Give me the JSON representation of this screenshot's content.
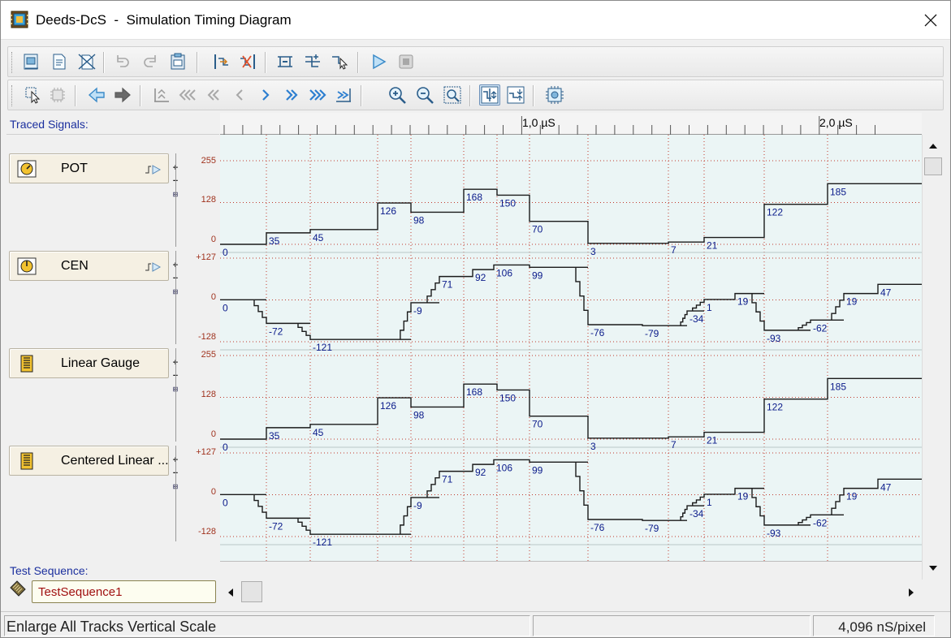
{
  "window": {
    "title": "Deeds-DcS  -  Simulation Timing Diagram"
  },
  "toolbar1": [
    {
      "icon": "new-diagram-icon"
    },
    {
      "icon": "open-file-icon"
    },
    {
      "icon": "delete-file-icon"
    },
    {
      "icon": "undo-icon"
    },
    {
      "icon": "redo-icon"
    },
    {
      "icon": "clipboard-icon"
    },
    {
      "icon": "insert-signal-icon"
    },
    {
      "icon": "remove-signal-icon"
    },
    {
      "icon": "align-signals-icon"
    },
    {
      "icon": "split-signals-icon"
    },
    {
      "icon": "select-pointer-icon"
    },
    {
      "icon": "play-icon"
    },
    {
      "icon": "stop-icon"
    }
  ],
  "toolbar2": [
    {
      "icon": "pointer-select-icon"
    },
    {
      "icon": "chip-disabled-icon"
    },
    {
      "icon": "arrow-left-icon"
    },
    {
      "icon": "arrow-right-icon"
    },
    {
      "icon": "go-start-icon"
    },
    {
      "icon": "fast-rewind-3-icon"
    },
    {
      "icon": "fast-rewind-2-icon"
    },
    {
      "icon": "step-back-icon"
    },
    {
      "icon": "step-forward-icon"
    },
    {
      "icon": "fast-forward-2-icon"
    },
    {
      "icon": "fast-forward-3-icon"
    },
    {
      "icon": "go-end-icon"
    },
    {
      "icon": "zoom-in-icon"
    },
    {
      "icon": "zoom-out-icon"
    },
    {
      "icon": "zoom-fit-icon"
    },
    {
      "icon": "enlarge-tracks-icon",
      "pressed": true
    },
    {
      "icon": "reduce-tracks-icon"
    },
    {
      "icon": "settings-chip-icon"
    }
  ],
  "left": {
    "traced_label": "Traced Signals:",
    "test_sequence_label": "Test Sequence:",
    "test_sequence_value": "TestSequence1"
  },
  "ruler": {
    "labels": [
      "1,0 µS",
      "2,0 µS"
    ]
  },
  "status": {
    "message": "Enlarge All Tracks Vertical Scale",
    "scale": "4,096 nS/pixel"
  },
  "colors": {
    "trace": "#1a1a1a",
    "value_label": "#0a1a8a",
    "grid_dot": "#c0392b",
    "scale_label": "#a0321e",
    "plot_bg": "#ebf5f5"
  },
  "chart_data": {
    "type": "line",
    "title": "",
    "xlabel": "",
    "ylabel": "",
    "x_unit": "µS",
    "x_tick_labels": [
      "1,0 µS",
      "2,0 µS"
    ],
    "series": [
      {
        "name": "POT",
        "icon": "knob-icon",
        "y_tick_labels": [
          "255",
          "128",
          "0"
        ],
        "ylim": [
          0,
          255
        ],
        "values": [
          0,
          35,
          45,
          126,
          98,
          168,
          150,
          70,
          3,
          7,
          21,
          122,
          185
        ]
      },
      {
        "name": "CEN",
        "icon": "centered-knob-icon",
        "y_tick_labels": [
          "+127",
          "0",
          "-128"
        ],
        "ylim": [
          -128,
          127
        ],
        "values": [
          0,
          -72,
          -121,
          -9,
          71,
          92,
          106,
          99,
          -76,
          -79,
          -34,
          1,
          19,
          -93,
          -62,
          19,
          47
        ]
      },
      {
        "name": "Linear Gauge",
        "icon": "gauge-icon",
        "y_tick_labels": [
          "255",
          "128",
          "0"
        ],
        "ylim": [
          0,
          255
        ],
        "values": [
          0,
          35,
          45,
          126,
          98,
          168,
          150,
          70,
          3,
          7,
          21,
          122,
          185
        ]
      },
      {
        "name": "Centered Linear ...",
        "icon": "gauge-icon",
        "y_tick_labels": [
          "+127",
          "0",
          "-128"
        ],
        "ylim": [
          -128,
          127
        ],
        "values": [
          0,
          -72,
          -121,
          -9,
          71,
          92,
          106,
          99,
          -76,
          -79,
          -34,
          1,
          19,
          -93,
          -62,
          19,
          47
        ]
      }
    ]
  }
}
